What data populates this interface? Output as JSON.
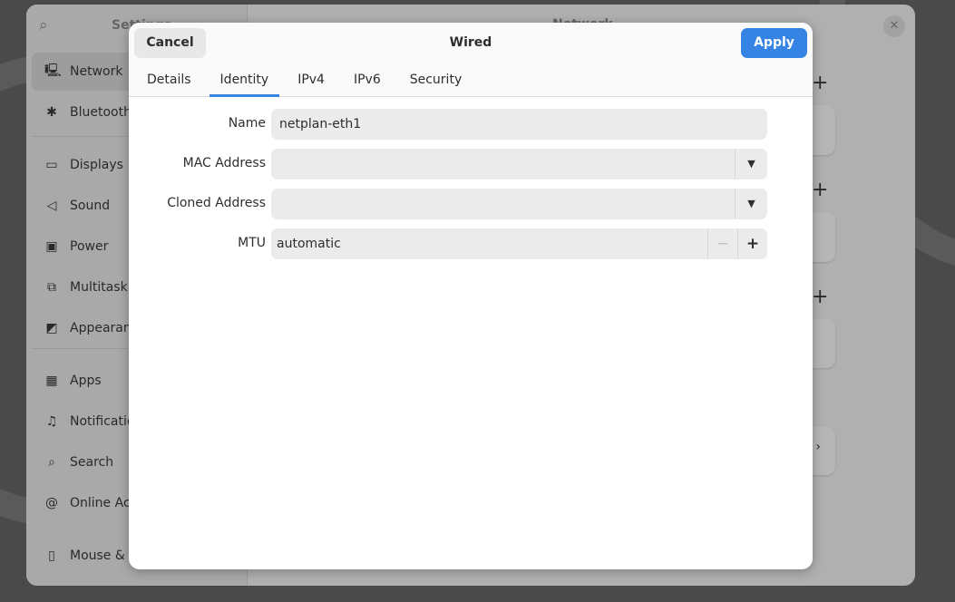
{
  "background_window": {
    "sidebar_title": "Settings",
    "main_title": "Network",
    "sidebar_items": [
      {
        "label": "Network",
        "icon": "network-wired-icon",
        "glyph": "🖳"
      },
      {
        "label": "Bluetooth",
        "icon": "bluetooth-icon",
        "glyph": "✱"
      },
      {
        "label": "Displays",
        "icon": "display-icon",
        "glyph": "▭"
      },
      {
        "label": "Sound",
        "icon": "speaker-icon",
        "glyph": "◁"
      },
      {
        "label": "Power",
        "icon": "power-icon",
        "glyph": "▣"
      },
      {
        "label": "Multitasking",
        "icon": "multitasking-icon",
        "glyph": "⧉"
      },
      {
        "label": "Appearance",
        "icon": "appearance-icon",
        "glyph": "◩"
      },
      {
        "label": "Apps",
        "icon": "apps-icon",
        "glyph": "▦"
      },
      {
        "label": "Notifications",
        "icon": "bell-icon",
        "glyph": "♫"
      },
      {
        "label": "Search",
        "icon": "search-icon",
        "glyph": "⌕"
      },
      {
        "label": "Online Accounts",
        "icon": "at-icon",
        "glyph": "@"
      },
      {
        "label": "Mouse & Touchpad",
        "icon": "mouse-icon",
        "glyph": "▯"
      }
    ]
  },
  "dialog": {
    "title": "Wired",
    "cancel_label": "Cancel",
    "apply_label": "Apply",
    "accent": "#3584e4",
    "tabs": [
      {
        "label": "Details"
      },
      {
        "label": "Identity",
        "selected": true
      },
      {
        "label": "IPv4"
      },
      {
        "label": "IPv6"
      },
      {
        "label": "Security"
      }
    ],
    "fields": {
      "name": {
        "label": "Name",
        "value": "netplan-eth1"
      },
      "mac": {
        "label": "MAC Address",
        "value": ""
      },
      "cloned": {
        "label": "Cloned Address",
        "value": ""
      },
      "mtu": {
        "label": "MTU",
        "value": "automatic",
        "decrement": "−",
        "increment": "+"
      }
    }
  }
}
